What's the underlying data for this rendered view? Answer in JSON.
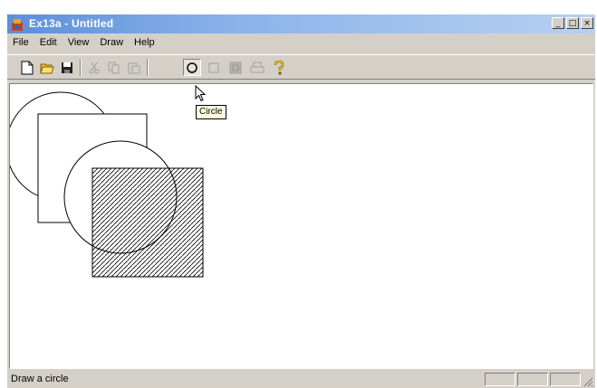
{
  "window": {
    "title": "Ex13a - Untitled",
    "controls": {
      "minimize": "_",
      "maximize": "□",
      "close": "×"
    }
  },
  "menu": [
    {
      "label": "File"
    },
    {
      "label": "Edit"
    },
    {
      "label": "View"
    },
    {
      "label": "Draw"
    },
    {
      "label": "Help"
    }
  ],
  "toolbar": {
    "buttons": [
      {
        "name": "new-icon",
        "enabled": true
      },
      {
        "name": "open-icon",
        "enabled": true
      },
      {
        "name": "save-icon",
        "enabled": true
      },
      {
        "name": "cut-icon",
        "enabled": false
      },
      {
        "name": "copy-icon",
        "enabled": false
      },
      {
        "name": "paste-icon",
        "enabled": false
      },
      {
        "name": "circle-icon",
        "enabled": true,
        "pressed": true
      },
      {
        "name": "square-icon",
        "enabled": false
      },
      {
        "name": "pattern-icon",
        "enabled": false
      },
      {
        "name": "print-icon",
        "enabled": false
      },
      {
        "name": "help-icon",
        "enabled": true
      }
    ]
  },
  "tooltip": {
    "text": "Circle"
  },
  "status": {
    "text": "Draw a circle"
  },
  "colors": {
    "titlebar_start": "#5a8fd8",
    "titlebar_end": "#b8d0f2",
    "face": "#d4d0c8",
    "canvas": "#ffffff",
    "tooltip_bg": "#ffffe1"
  }
}
